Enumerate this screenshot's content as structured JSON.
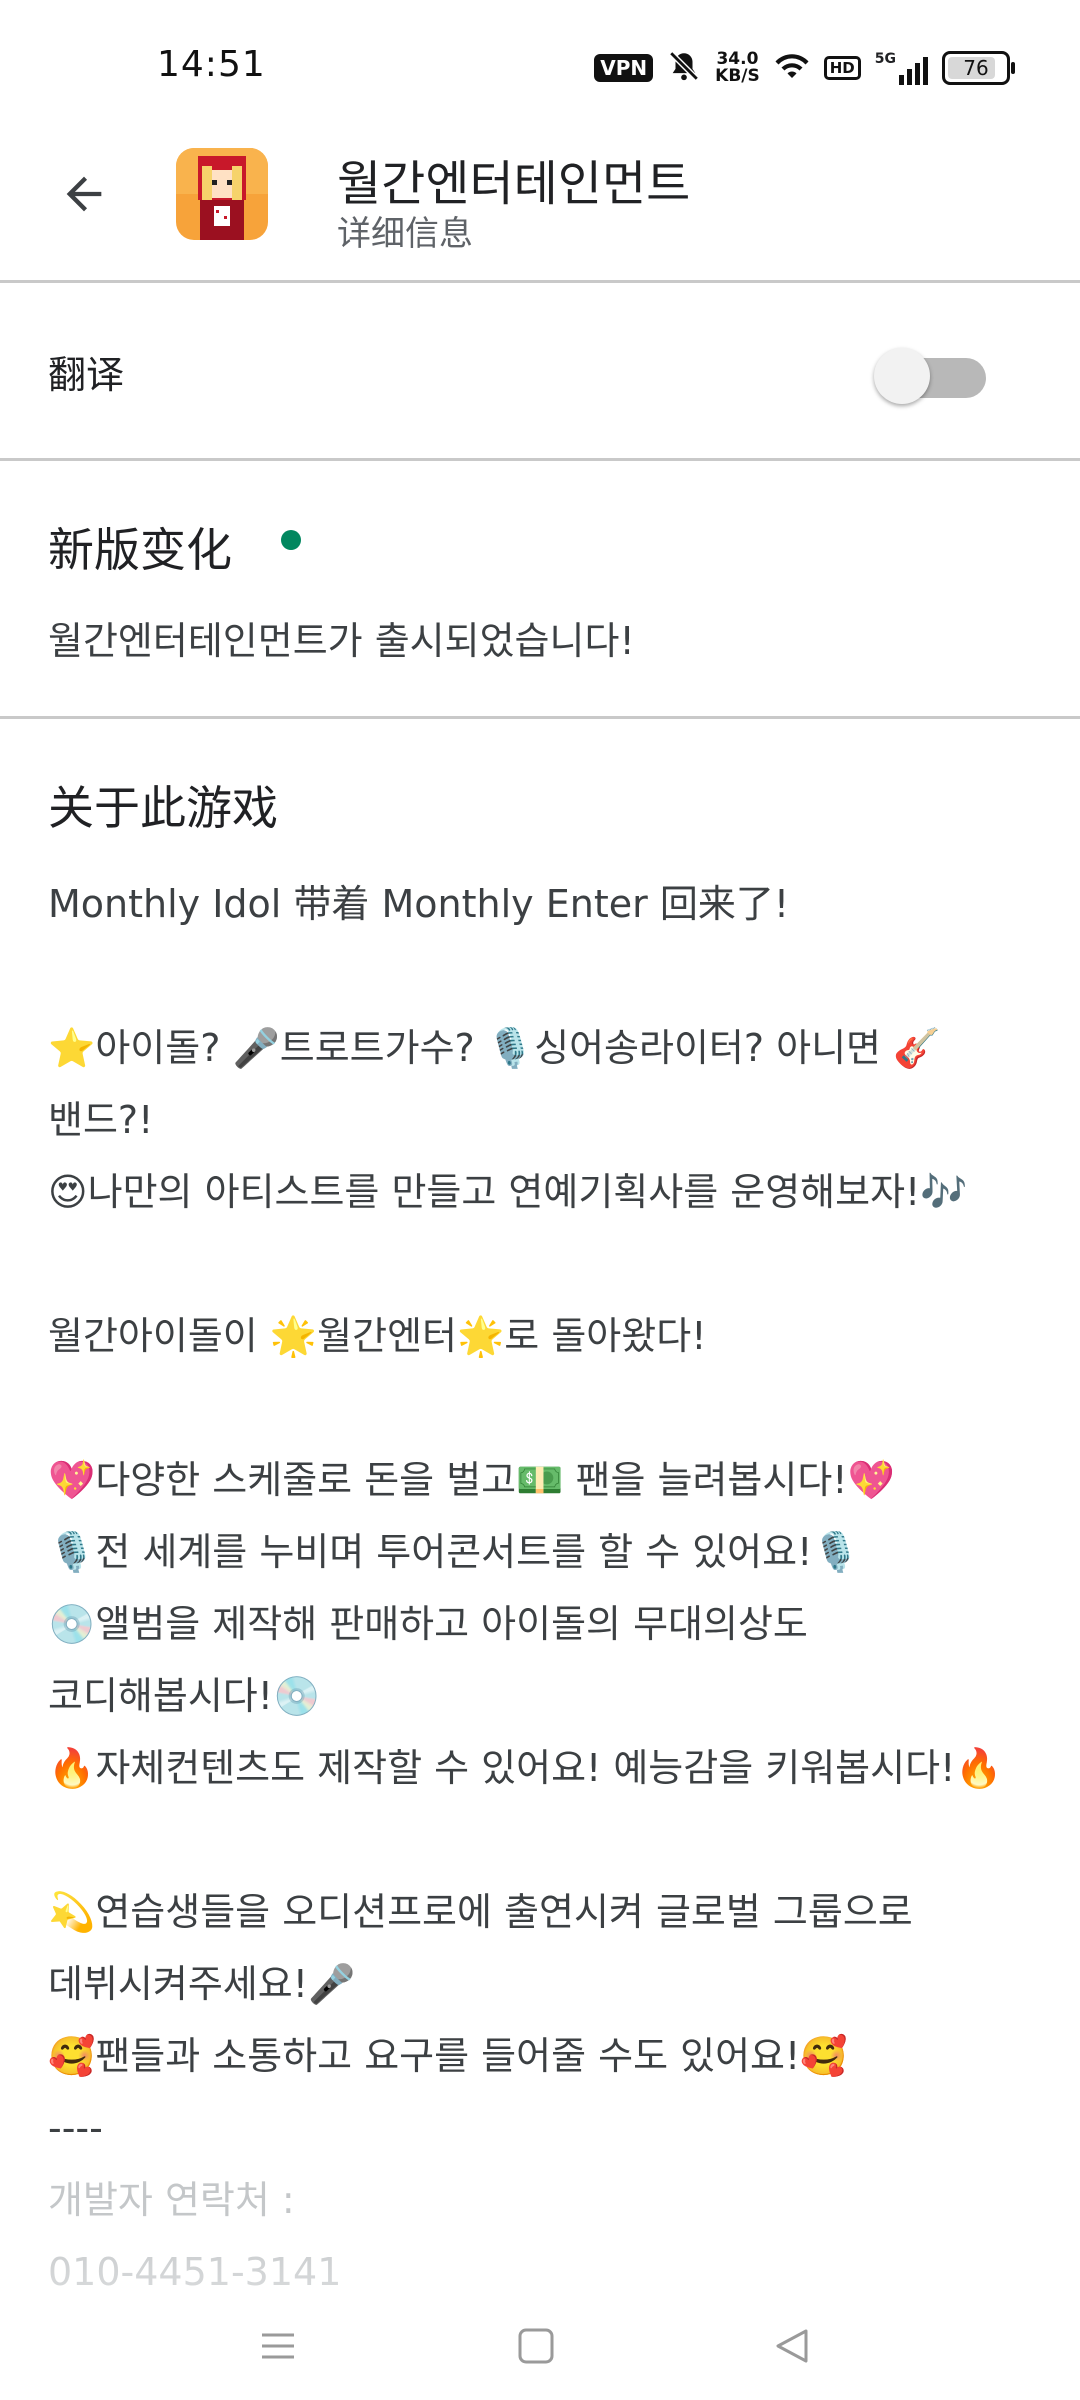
{
  "status_bar": {
    "time": "14:51",
    "vpn": "VPN",
    "speed_value": "34.0",
    "speed_unit": "KB/S",
    "hd": "HD",
    "network": "5G",
    "battery": "76"
  },
  "header": {
    "app_name": "월간엔터테인먼트",
    "subtitle": "详细信息",
    "back_icon": "arrow-left-icon"
  },
  "translate": {
    "label": "翻译",
    "enabled": false
  },
  "whats_new": {
    "title": "新版变化",
    "text": "월간엔터테인먼트가 출시되었습니다!",
    "dot_color": "#01875f"
  },
  "about": {
    "title": "关于此游戏",
    "body": "Monthly Idol 带着 Monthly Enter 回来了!\n\n⭐아이돌? 🎤트로트가수? 🎙️싱어송라이터? 아니면 🎸밴드?!\n😍나만의 아티스트를 만들고 연예기획사를 운영해보자!🎶\n\n월간아이돌이 🌟월간엔터🌟로 돌아왔다!\n\n💖다양한 스케줄로 돈을 벌고💵 팬을 늘려봅시다!💖\n🎙️전 세계를 누비며 투어콘서트를 할 수 있어요!🎙️\n💿앨범을 제작해 판매하고 아이돌의 무대의상도 코디해봅시다!💿\n🔥자체컨텐츠도 제작할 수 있어요! 예능감을 키워봅시다!🔥\n\n💫연습생들을 오디션프로에 출연시켜 글로벌 그룹으로 데뷔시켜주세요!🎤\n🥰팬들과 소통하고 요구를 들어줄 수도 있어요!🥰\n----",
    "tail_line1": "개발자 연락처 :",
    "tail_line2": "010-4451-3141"
  },
  "nav": {
    "menu_icon": "menu-icon",
    "home_icon": "square-home-icon",
    "back_icon": "triangle-back-icon"
  }
}
